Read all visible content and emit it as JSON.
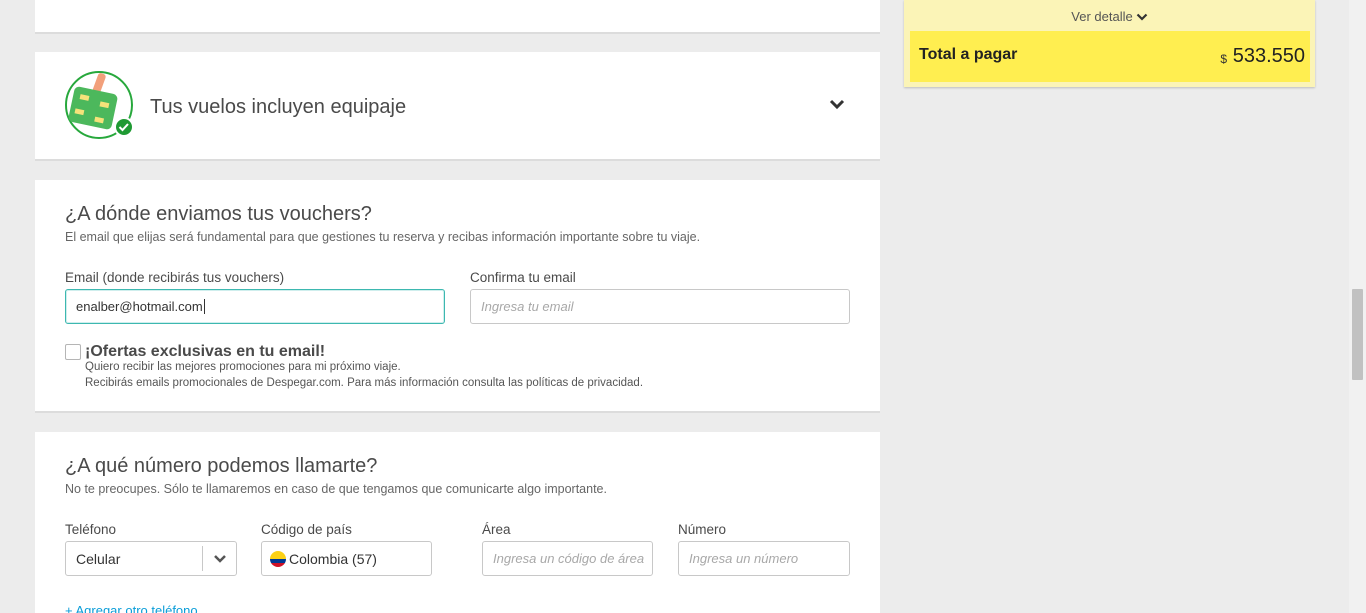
{
  "luggage": {
    "title": "Tus vuelos incluyen equipaje",
    "icon": "luggage-check-icon"
  },
  "email_section": {
    "title": "¿A dónde enviamos tus vouchers?",
    "subtitle": "El email que elijas será fundamental para que gestiones tu reserva y recibas información importante sobre tu viaje.",
    "email_label": "Email (donde recibirás tus vouchers)",
    "email_value": "enalber@hotmail.com",
    "confirm_label": "Confirma tu email",
    "confirm_placeholder": "Ingresa tu email",
    "offers_title": "¡Ofertas exclusivas en tu email!",
    "offers_line1": "Quiero recibir las mejores promociones para mi próximo viaje.",
    "offers_line2": "Recibirás emails promocionales de Despegar.com. Para más información consulta las políticas de privacidad.",
    "offers_checked": false
  },
  "phone_section": {
    "title": "¿A qué número podemos llamarte?",
    "subtitle": "No te preocupes. Sólo te llamaremos en caso de que tengamos que comunicarte algo importante.",
    "type_label": "Teléfono",
    "type_value": "Celular",
    "country_label": "Código de país",
    "country_value": "Colombia (57)",
    "area_label": "Área",
    "area_placeholder": "Ingresa un código de área",
    "number_label": "Número",
    "number_placeholder": "Ingresa un número",
    "add_phone": "+ Agregar otro teléfono"
  },
  "summary": {
    "detail_link": "Ver detalle",
    "total_label": "Total a pagar",
    "currency": "$",
    "total_amount": "533.550"
  },
  "colors": {
    "accent_teal": "#3db8b0",
    "total_bg": "#ffee50",
    "summary_bg": "#fbf4b7",
    "link": "#0a9dd8"
  }
}
